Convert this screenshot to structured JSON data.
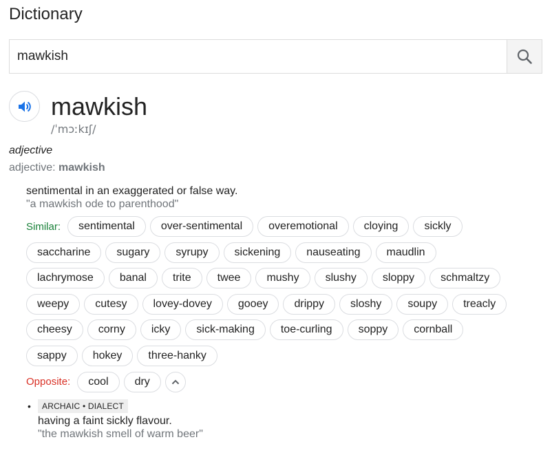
{
  "header": {
    "title": "Dictionary"
  },
  "search": {
    "query": "mawkish",
    "button_icon": "search-icon"
  },
  "entry": {
    "word": "mawkish",
    "phonetic": "/ˈmɔːkɪʃ/",
    "audio_icon": "speaker-icon",
    "part_of_speech": "adjective",
    "form_prefix": "adjective: ",
    "form_word": "mawkish",
    "senses": [
      {
        "definition": "sentimental in an exaggerated or false way.",
        "example": "\"a mawkish ode to parenthood\"",
        "similar_label": "Similar:",
        "similar_rows": [
          [
            "sentimental",
            "over-sentimental",
            "overemotional",
            "cloying",
            "sickly"
          ],
          [
            "saccharine",
            "sugary",
            "syrupy",
            "sickening",
            "nauseating",
            "maudlin"
          ],
          [
            "lachrymose",
            "banal",
            "trite",
            "twee",
            "mushy",
            "slushy",
            "sloppy",
            "schmaltzy"
          ],
          [
            "weepy",
            "cutesy",
            "lovey-dovey",
            "gooey",
            "drippy",
            "sloshy",
            "soupy",
            "treacly"
          ],
          [
            "cheesy",
            "corny",
            "icky",
            "sick-making",
            "toe-curling",
            "soppy",
            "cornball"
          ],
          [
            "sappy",
            "hokey",
            "three-hanky"
          ]
        ],
        "opposite_label": "Opposite:",
        "opposites": [
          "cool",
          "dry"
        ],
        "collapse_icon": "chevron-up-icon"
      },
      {
        "tag": "ARCHAIC • DIALECT",
        "definition": "having a faint sickly flavour.",
        "example": "\"the mawkish smell of warm beer\""
      }
    ]
  },
  "colors": {
    "similar": "#188038",
    "opposite": "#d93025",
    "speaker": "#1a73e8",
    "muted": "#70757a"
  }
}
